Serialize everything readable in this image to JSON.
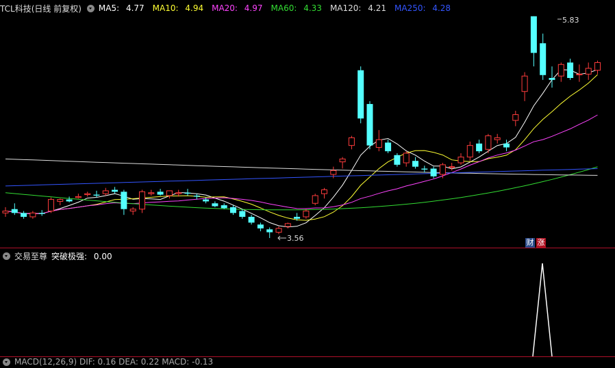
{
  "main_panel": {
    "stock_title": "TCL科技(日线 前复权)",
    "ma": [
      {
        "label": "MA5:",
        "value": "4.77",
        "color": "#ffffff"
      },
      {
        "label": "MA10:",
        "value": "4.94",
        "color": "#ffff33"
      },
      {
        "label": "MA20:",
        "value": "4.97",
        "color": "#ff44ff"
      },
      {
        "label": "MA60:",
        "value": "4.33",
        "color": "#33dd33"
      },
      {
        "label": "MA120:",
        "value": "4.21",
        "color": "#dddddd"
      },
      {
        "label": "MA250:",
        "value": "4.28",
        "color": "#3355ff"
      }
    ],
    "high_label": "5.83",
    "low_label": "3.56",
    "badges": {
      "cai": "财",
      "zhang": "涨"
    }
  },
  "sub_panel": {
    "indicator_name": "交易至尊",
    "series_label": "突破极强:",
    "series_value": "0.00"
  },
  "bottom_panel": {
    "text": "MACD(12,26,9) DIF: 0.16 DEA: 0.22 MACD: -0.13"
  },
  "chart_data": {
    "type": "candlestick",
    "y_range": [
      3.45,
      5.9
    ],
    "candles": [
      [
        3.82,
        3.88,
        3.78,
        3.84
      ],
      [
        3.86,
        3.92,
        3.8,
        3.82
      ],
      [
        3.82,
        3.84,
        3.76,
        3.78
      ],
      [
        3.78,
        3.84,
        3.76,
        3.82
      ],
      [
        3.82,
        3.85,
        3.79,
        3.81
      ],
      [
        3.84,
        3.98,
        3.82,
        3.96
      ],
      [
        3.94,
        3.97,
        3.9,
        3.96
      ],
      [
        3.96,
        3.99,
        3.93,
        3.94
      ],
      [
        3.98,
        4.02,
        3.97,
        3.99
      ],
      [
        4.01,
        4.04,
        3.99,
        4.02
      ],
      [
        4.01,
        4.05,
        3.98,
        4.0
      ],
      [
        4.02,
        4.08,
        4.0,
        4.05
      ],
      [
        4.06,
        4.09,
        4.02,
        4.04
      ],
      [
        4.04,
        4.06,
        3.8,
        3.86
      ],
      [
        3.84,
        3.88,
        3.8,
        3.86
      ],
      [
        3.86,
        4.06,
        3.82,
        4.04
      ],
      [
        4.02,
        4.06,
        4.0,
        4.03
      ],
      [
        4.04,
        4.07,
        4.0,
        4.01
      ],
      [
        4.0,
        4.03,
        3.97,
        4.05
      ],
      [
        4.02,
        4.06,
        3.99,
        4.03
      ],
      [
        4.03,
        4.07,
        4.0,
        4.02
      ],
      [
        4.0,
        4.02,
        3.96,
        3.99
      ],
      [
        3.96,
        3.98,
        3.92,
        3.94
      ],
      [
        3.92,
        3.94,
        3.88,
        3.89
      ],
      [
        3.9,
        3.92,
        3.86,
        3.87
      ],
      [
        3.88,
        3.9,
        3.8,
        3.82
      ],
      [
        3.84,
        3.86,
        3.76,
        3.78
      ],
      [
        3.78,
        3.8,
        3.7,
        3.72
      ],
      [
        3.7,
        3.72,
        3.63,
        3.66
      ],
      [
        3.65,
        3.67,
        3.56,
        3.62
      ],
      [
        3.62,
        3.68,
        3.6,
        3.66
      ],
      [
        3.68,
        3.72,
        3.66,
        3.71
      ],
      [
        3.78,
        3.82,
        3.74,
        3.76
      ],
      [
        3.78,
        3.86,
        3.76,
        3.84
      ],
      [
        3.92,
        4.02,
        3.9,
        4.0
      ],
      [
        4.02,
        4.08,
        3.97,
        4.06
      ],
      [
        4.22,
        4.3,
        4.18,
        4.26
      ],
      [
        4.35,
        4.4,
        4.28,
        4.38
      ],
      [
        4.52,
        4.62,
        4.48,
        4.6
      ],
      [
        5.3,
        5.34,
        4.75,
        4.8
      ],
      [
        4.95,
        4.98,
        4.48,
        4.52
      ],
      [
        4.5,
        4.68,
        4.46,
        4.58
      ],
      [
        4.55,
        4.58,
        4.44,
        4.46
      ],
      [
        4.42,
        4.44,
        4.3,
        4.32
      ],
      [
        4.34,
        4.46,
        4.3,
        4.44
      ],
      [
        4.36,
        4.4,
        4.28,
        4.3
      ],
      [
        4.28,
        4.31,
        4.24,
        4.27
      ],
      [
        4.28,
        4.3,
        4.18,
        4.2
      ],
      [
        4.22,
        4.34,
        4.18,
        4.32
      ],
      [
        4.3,
        4.34,
        4.26,
        4.3
      ],
      [
        4.34,
        4.44,
        4.32,
        4.4
      ],
      [
        4.4,
        4.56,
        4.36,
        4.52
      ],
      [
        4.54,
        4.58,
        4.44,
        4.46
      ],
      [
        4.48,
        4.64,
        4.44,
        4.62
      ],
      [
        4.58,
        4.64,
        4.54,
        4.6
      ],
      [
        4.54,
        4.58,
        4.46,
        4.5
      ],
      [
        4.78,
        4.88,
        4.72,
        4.84
      ],
      [
        5.08,
        5.28,
        4.98,
        5.24
      ],
      [
        5.86,
        5.86,
        5.34,
        5.48
      ],
      [
        5.58,
        5.68,
        5.2,
        5.25
      ],
      [
        5.22,
        5.34,
        5.12,
        5.2
      ],
      [
        5.24,
        5.38,
        5.18,
        5.36
      ],
      [
        5.38,
        5.42,
        5.2,
        5.22
      ],
      [
        5.26,
        5.36,
        5.18,
        5.26
      ],
      [
        5.26,
        5.38,
        5.2,
        5.32
      ],
      [
        5.3,
        5.4,
        5.26,
        5.38
      ]
    ]
  }
}
